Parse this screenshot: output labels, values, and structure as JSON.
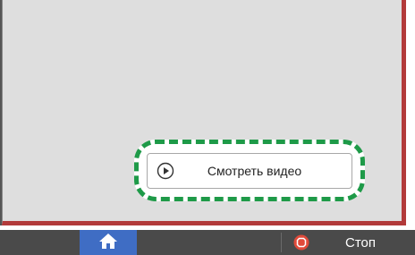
{
  "dialog": {
    "video_button": {
      "label": "Смотреть видео",
      "icon": "play-circle-icon"
    },
    "highlight_color": "#1e9a48",
    "border_color": "#b23a3a"
  },
  "bottom_bar": {
    "home_button": {
      "icon": "home-icon",
      "color": "#3f6dc4"
    },
    "stop_button": {
      "label": "Стоп",
      "icon": "stop-icon",
      "icon_color": "#e04a3a"
    }
  }
}
